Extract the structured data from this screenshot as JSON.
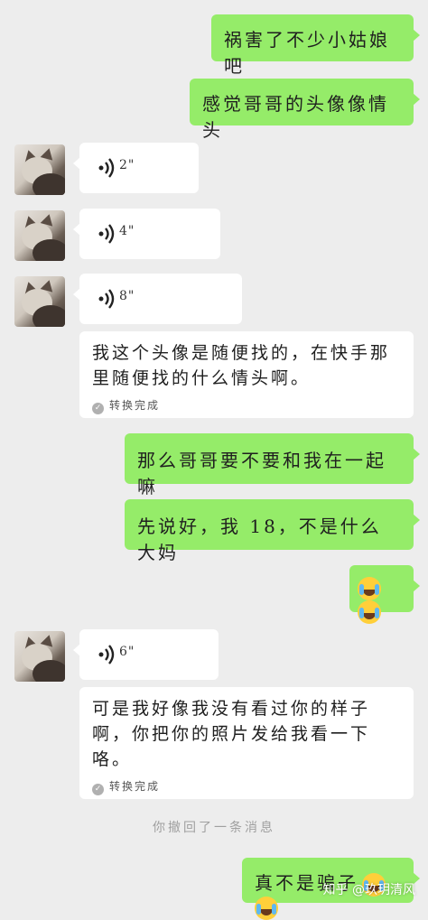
{
  "colors": {
    "background": "#ededed",
    "outgoing_bubble": "#95ec69",
    "incoming_bubble": "#ffffff"
  },
  "messages": [
    {
      "side": "right",
      "type": "text",
      "text": "祸害了不少小姑娘吧"
    },
    {
      "side": "right",
      "type": "text",
      "text": "感觉哥哥的头像像情头"
    },
    {
      "side": "left",
      "type": "voice",
      "duration": "2\""
    },
    {
      "side": "left",
      "type": "voice",
      "duration": "4\""
    },
    {
      "side": "left",
      "type": "voice",
      "duration": "8\""
    },
    {
      "side": "left",
      "type": "transcript",
      "text": "我这个头像是随便找的，在快手那里随便找的什么情头啊。",
      "note": "转换完成"
    },
    {
      "side": "right",
      "type": "text",
      "text": "那么哥哥要不要和我在一起嘛"
    },
    {
      "side": "right",
      "type": "text",
      "text": "先说好，我 18，不是什么大妈"
    },
    {
      "side": "right",
      "type": "emoji",
      "icons": [
        "crying-laughing-emoji",
        "crying-laughing-emoji"
      ]
    },
    {
      "side": "left",
      "type": "voice",
      "duration": "6\""
    },
    {
      "side": "left",
      "type": "transcript",
      "text": "可是我好像我没有看过你的样子啊，你把你的照片发给我看一下咯。",
      "note": "转换完成"
    },
    {
      "side": "right",
      "type": "text",
      "text": "真不是骗子",
      "icons": [
        "crying-laughing-emoji",
        "crying-laughing-emoji"
      ]
    }
  ],
  "system": {
    "recall_notice": "你撤回了一条消息"
  },
  "watermark": {
    "text": "知乎 @玖玥清风"
  }
}
